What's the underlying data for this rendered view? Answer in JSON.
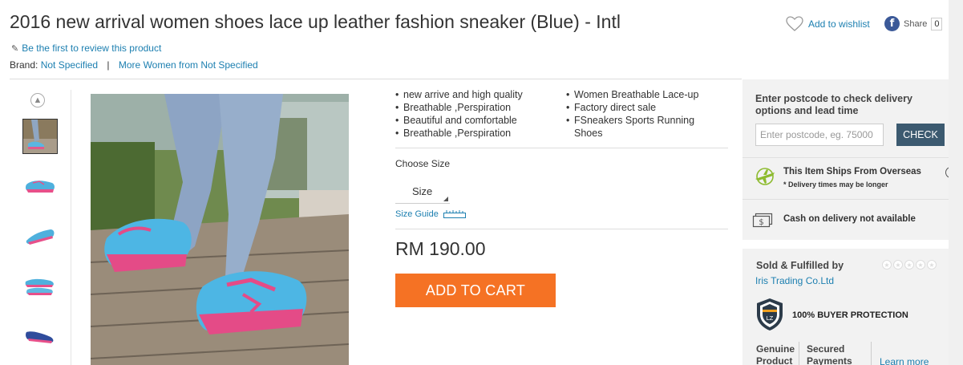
{
  "product": {
    "title": "2016 new arrival women shoes lace up leather fashion sneaker (Blue) - Intl",
    "review_link": "Be the first to review this product",
    "brand_label": "Brand:",
    "brand_value": "Not Specified",
    "brand_more": "More Women from Not Specified",
    "wishlist_label": "Add to wishlist",
    "share_label": "Share",
    "share_count": "0"
  },
  "features": {
    "left": [
      "new arrive and high quality",
      "Breathable ,Perspiration",
      "Beautiful and comfortable",
      "Breathable ,Perspiration"
    ],
    "right": [
      "Women Breathable Lace-up",
      "Factory direct sale",
      "FSneakers Sports Running Shoes"
    ]
  },
  "options": {
    "choose_size": "Choose Size",
    "size_select": "Size",
    "size_guide": "Size Guide"
  },
  "price": "RM 190.00",
  "cart_button": "ADD TO CART",
  "delivery": {
    "title_line1": "Enter postcode to check delivery",
    "title_line2": "options and lead time",
    "postcode_placeholder": "Enter postcode, eg. 75000",
    "check_button": "CHECK",
    "ships_overseas": "This Item Ships From Overseas",
    "ships_note": "* Delivery times may be longer",
    "cod": "Cash on delivery not available"
  },
  "seller": {
    "title": "Sold & Fulfilled by",
    "name": "Iris Trading Co.Ltd",
    "protection": "100% BUYER PROTECTION",
    "col1": [
      "Genuine",
      "Product"
    ],
    "col2": [
      "Secured",
      "Payments"
    ],
    "learn_more": "Learn more"
  },
  "colors": {
    "accent_orange": "#f57224",
    "link_blue": "#1c7fb0",
    "check_button": "#3c5a70",
    "panel_bg": "#f2f2f2"
  }
}
